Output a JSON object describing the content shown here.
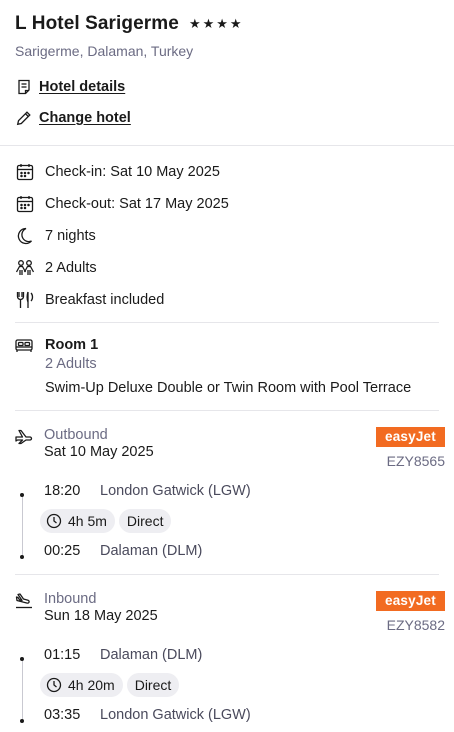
{
  "hotel": {
    "name": "L Hotel Sarigerme",
    "stars": "★★★★",
    "location": "Sarigerme, Dalaman, Turkey",
    "details_link": "Hotel details",
    "change_link": "Change hotel"
  },
  "stay": {
    "check_in": "Check-in: Sat 10 May 2025",
    "check_out": "Check-out: Sat 17 May 2025",
    "nights": "7 nights",
    "guests": "2 Adults",
    "board": "Breakfast included"
  },
  "room": {
    "title": "Room 1",
    "occupancy": "2 Adults",
    "description": "Swim-Up Deluxe Double or Twin Room with Pool Terrace"
  },
  "outbound": {
    "label": "Outbound",
    "date": "Sat 10 May 2025",
    "airline": "easyJet",
    "flight_number": "EZY8565",
    "depart_time": "18:20",
    "depart_place": "London Gatwick (LGW)",
    "duration": "4h 5m",
    "stops": "Direct",
    "arrive_time": "00:25",
    "arrive_place": "Dalaman (DLM)"
  },
  "inbound": {
    "label": "Inbound",
    "date": "Sun 18 May 2025",
    "airline": "easyJet",
    "flight_number": "EZY8582",
    "depart_time": "01:15",
    "depart_place": "Dalaman (DLM)",
    "duration": "4h 20m",
    "stops": "Direct",
    "arrive_time": "03:35",
    "arrive_place": "London Gatwick (LGW)"
  },
  "colors": {
    "airline_brand": "#f26b21",
    "muted_text": "#6b6b83",
    "chip_bg": "#eeeef2"
  },
  "icons": [
    "document-icon",
    "pencil-icon",
    "calendar-icon",
    "moon-icon",
    "people-icon",
    "cutlery-icon",
    "bed-icon",
    "plane-takeoff-icon",
    "plane-landing-icon",
    "clock-icon"
  ]
}
